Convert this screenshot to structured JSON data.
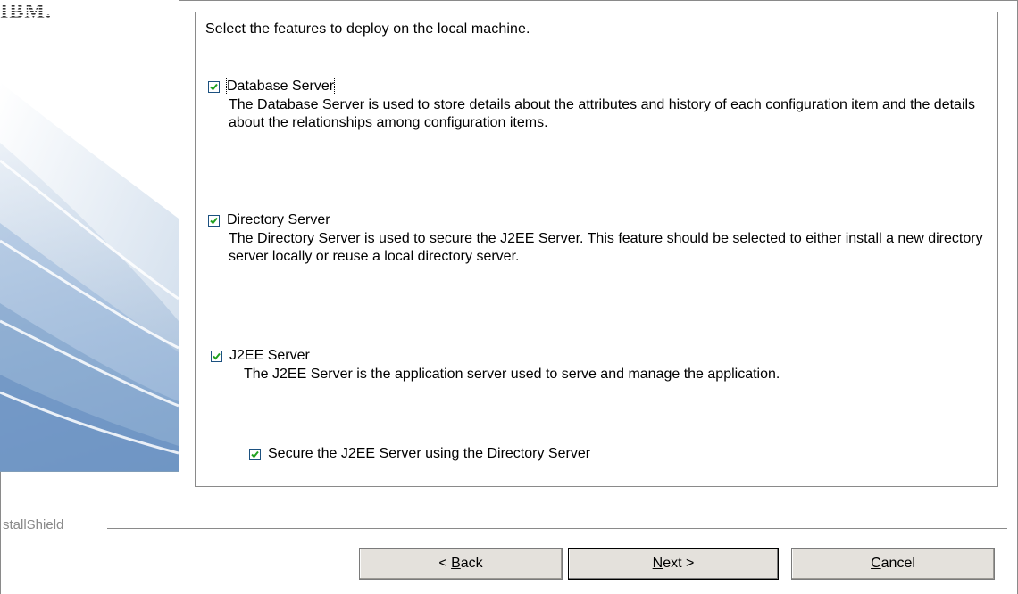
{
  "brand": {
    "logo_text": "IBM."
  },
  "instruction": "Select the features to deploy on the local machine.",
  "features": [
    {
      "label": "Database Server",
      "checked": true,
      "description": "The Database Server is used to store details about the attributes and history of each configuration item and the details about the relationships among configuration items."
    },
    {
      "label": "Directory Server",
      "checked": true,
      "description": "The Directory Server is used to secure the J2EE Server. This feature should be selected to either install a new directory server locally or reuse a local directory server."
    },
    {
      "label": "J2EE Server",
      "checked": true,
      "description": "The J2EE Server is the application server used to serve and manage the application."
    }
  ],
  "sub_option": {
    "label": "Secure the J2EE Server using the Directory Server",
    "checked": true
  },
  "footer": {
    "installshield_label": "stallShield"
  },
  "buttons": {
    "back": {
      "prefix": "< ",
      "mnemonic": "B",
      "rest": "ack"
    },
    "next": {
      "mnemonic": "N",
      "rest": "ext >"
    },
    "cancel": {
      "mnemonic": "C",
      "rest": "ancel"
    }
  },
  "colors": {
    "accent": "#7f9db9",
    "button_face": "#e4e1dc"
  }
}
